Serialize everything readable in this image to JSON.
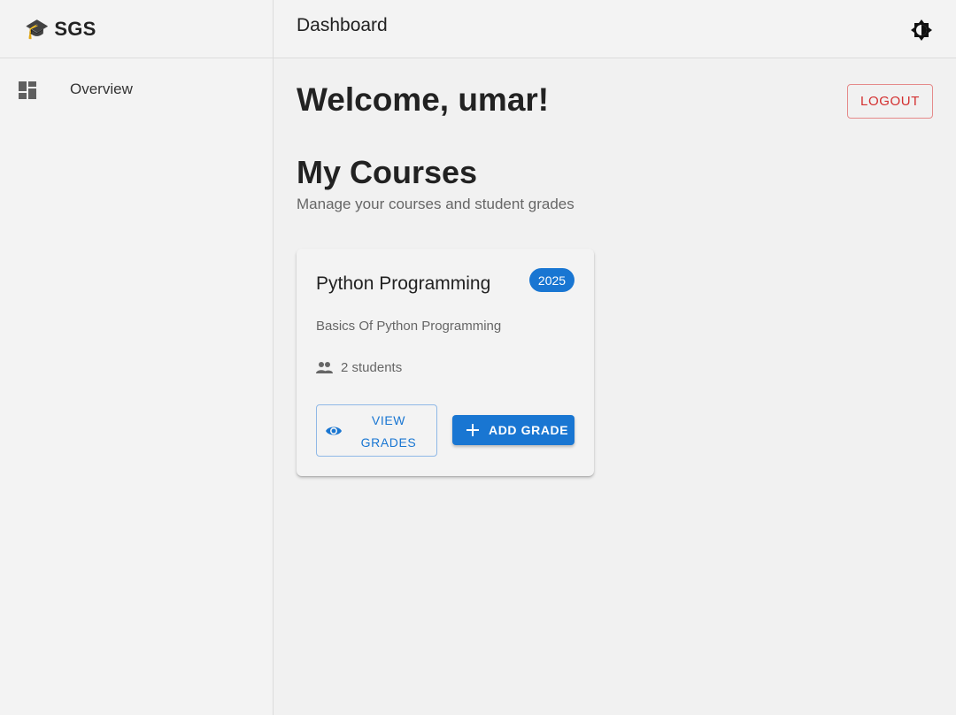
{
  "app": {
    "brand_icon": "🎓",
    "brand_name": "SGS"
  },
  "sidebar": {
    "items": [
      {
        "label": "Overview",
        "icon": "dashboard-icon"
      }
    ]
  },
  "header": {
    "title": "Dashboard",
    "theme_icon": "brightness-icon"
  },
  "main": {
    "welcome": "Welcome, umar!",
    "logout_label": "LOGOUT",
    "section_title": "My Courses",
    "section_subtitle": "Manage your courses and student grades"
  },
  "courses": [
    {
      "title": "Python Programming",
      "year": "2025",
      "description": "Basics Of Python Programming",
      "students": "2 students",
      "view_label": "VIEW GRADES",
      "add_label": "ADD GRADE"
    }
  ],
  "colors": {
    "primary": "#1976d2",
    "danger": "#d32f2f"
  }
}
